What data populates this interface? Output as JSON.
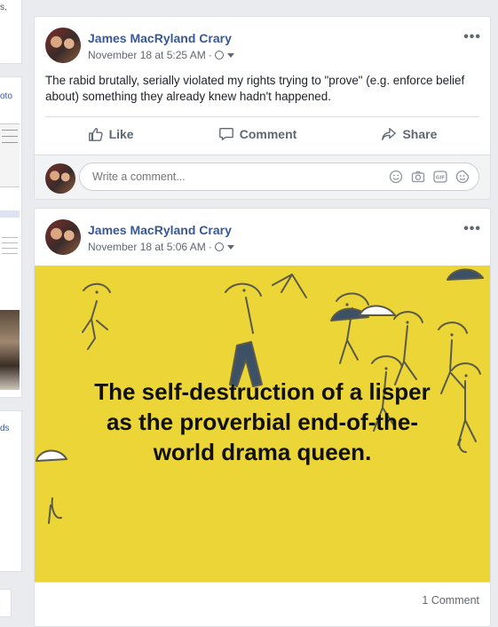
{
  "left_column": {
    "fragment_top": "s,",
    "fragment_photo": "oto",
    "fragment_ds": "ds"
  },
  "posts": [
    {
      "author": "James MacRyland Crary",
      "timestamp": "November 18 at 5:25 AM",
      "text": "The rabid brutally, serially violated my rights trying to \"prove\" (e.g. enforce belief about) something they already knew hadn't happened.",
      "actions": {
        "like": "Like",
        "comment": "Comment",
        "share": "Share"
      },
      "comment_placeholder": "Write a comment..."
    },
    {
      "author": "James MacRyland Crary",
      "timestamp": "November 18 at 5:06 AM",
      "image_text": [
        "The self-destruction of a lisper",
        "as the proverbial end-of-the-",
        "world drama queen."
      ],
      "comments_count": "1 Comment",
      "image_bg": "#ecd537"
    }
  ],
  "icons": {
    "privacy": "globe-icon",
    "menu": "more-options-icon",
    "like": "thumbs-up-icon",
    "comment": "speech-bubble-icon",
    "share": "share-arrow-icon",
    "emoji": "smiley-icon",
    "camera": "camera-icon",
    "gif": "gif-icon",
    "sticker": "sticker-icon"
  },
  "colors": {
    "link": "#385898",
    "background": "#e9ebee"
  }
}
